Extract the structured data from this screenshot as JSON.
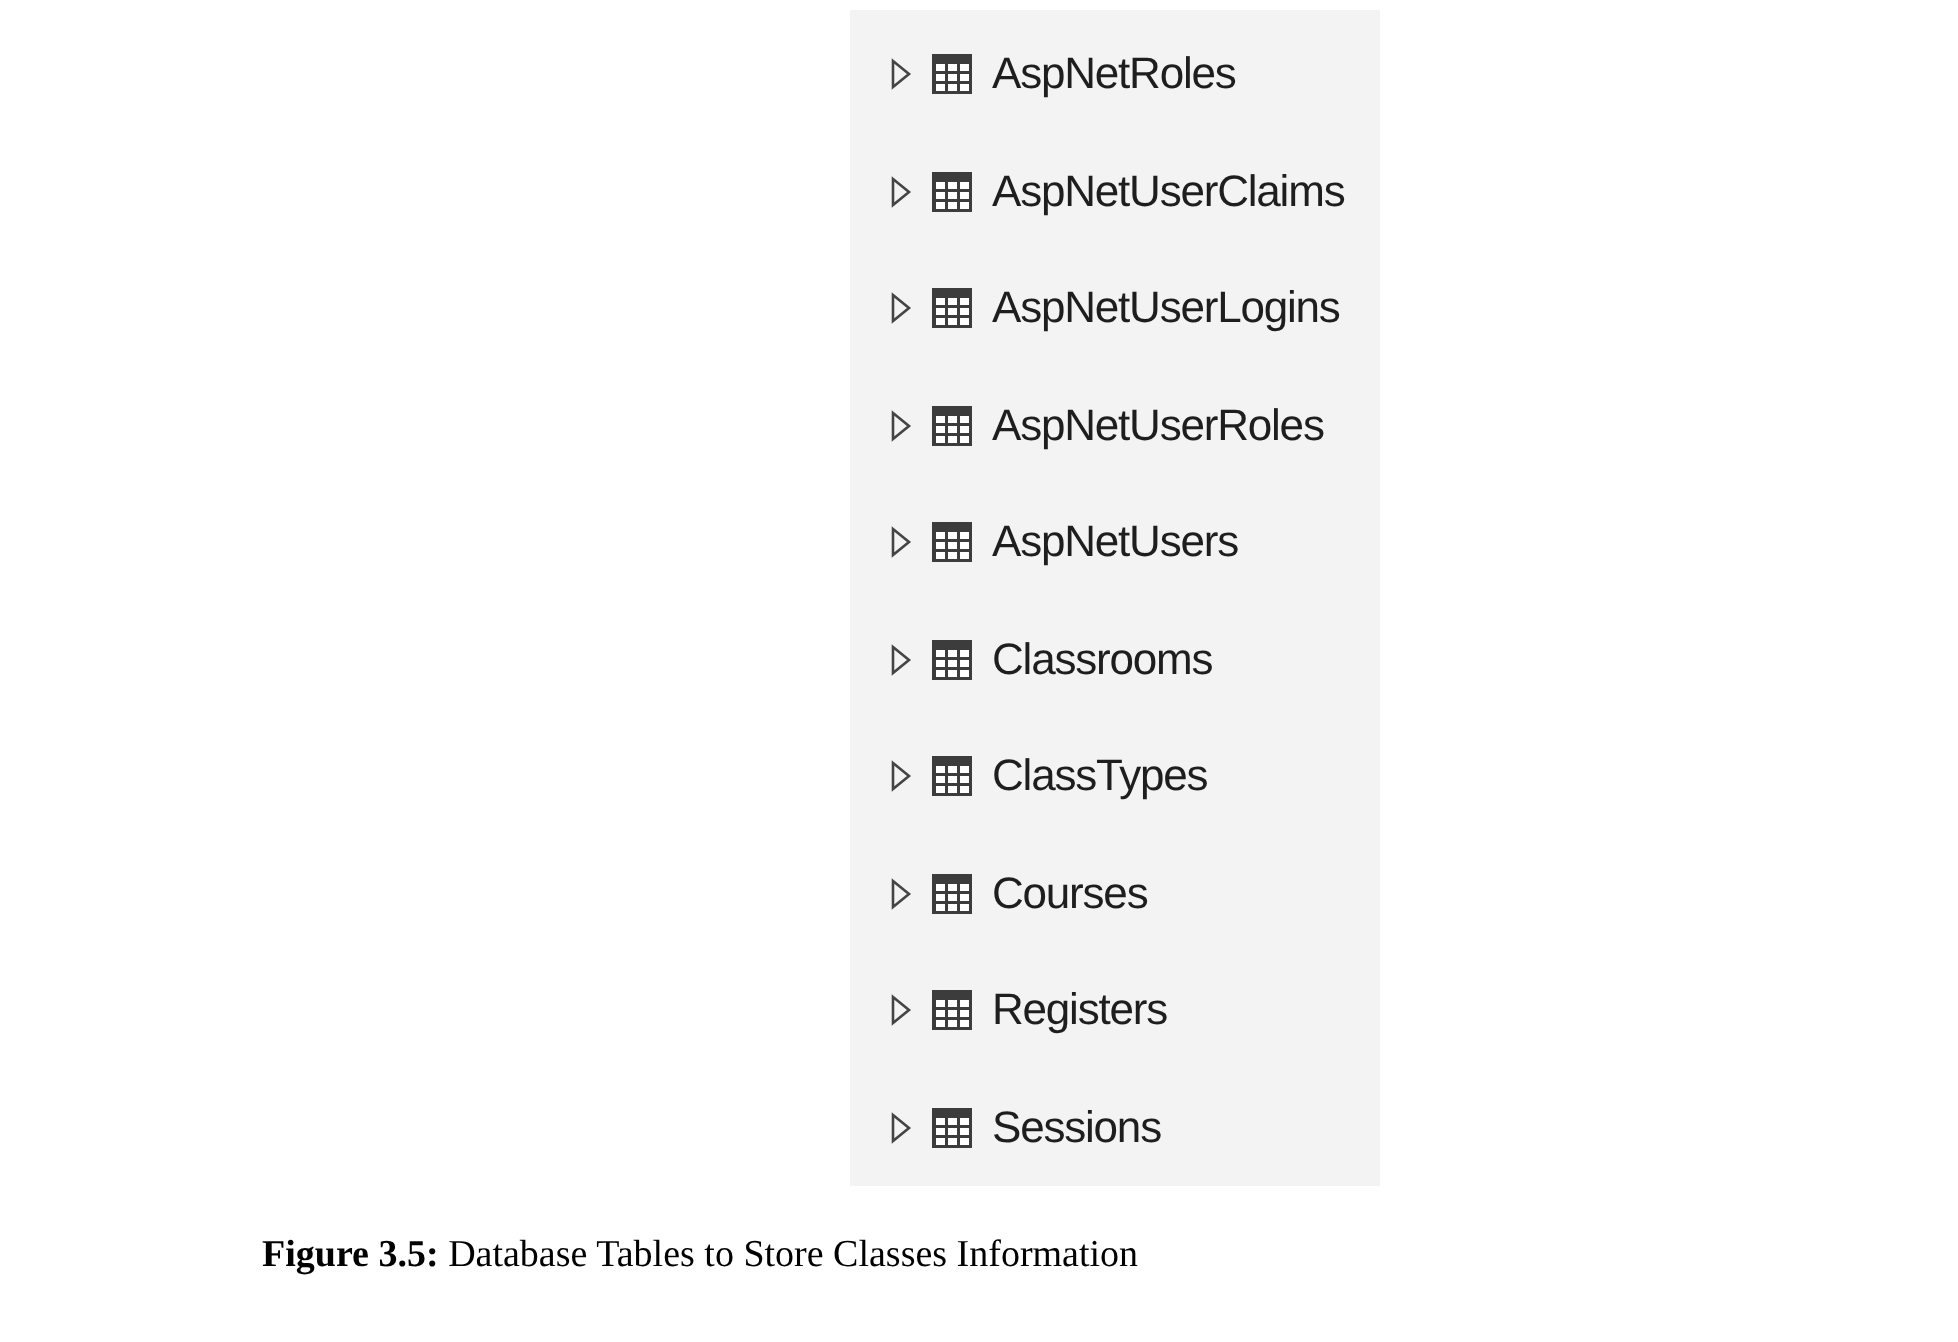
{
  "tree": {
    "items": [
      {
        "label": "AspNetRoles",
        "expanded": false
      },
      {
        "label": "AspNetUserClaims",
        "expanded": false
      },
      {
        "label": "AspNetUserLogins",
        "expanded": false
      },
      {
        "label": "AspNetUserRoles",
        "expanded": false
      },
      {
        "label": "AspNetUsers",
        "expanded": false
      },
      {
        "label": "Classrooms",
        "expanded": false
      },
      {
        "label": "ClassTypes",
        "expanded": false
      },
      {
        "label": "Courses",
        "expanded": false
      },
      {
        "label": "Registers",
        "expanded": false
      },
      {
        "label": "Sessions",
        "expanded": false
      }
    ]
  },
  "caption": {
    "label": "Figure 3.5:",
    "text": "Database Tables to Store Classes Information"
  }
}
